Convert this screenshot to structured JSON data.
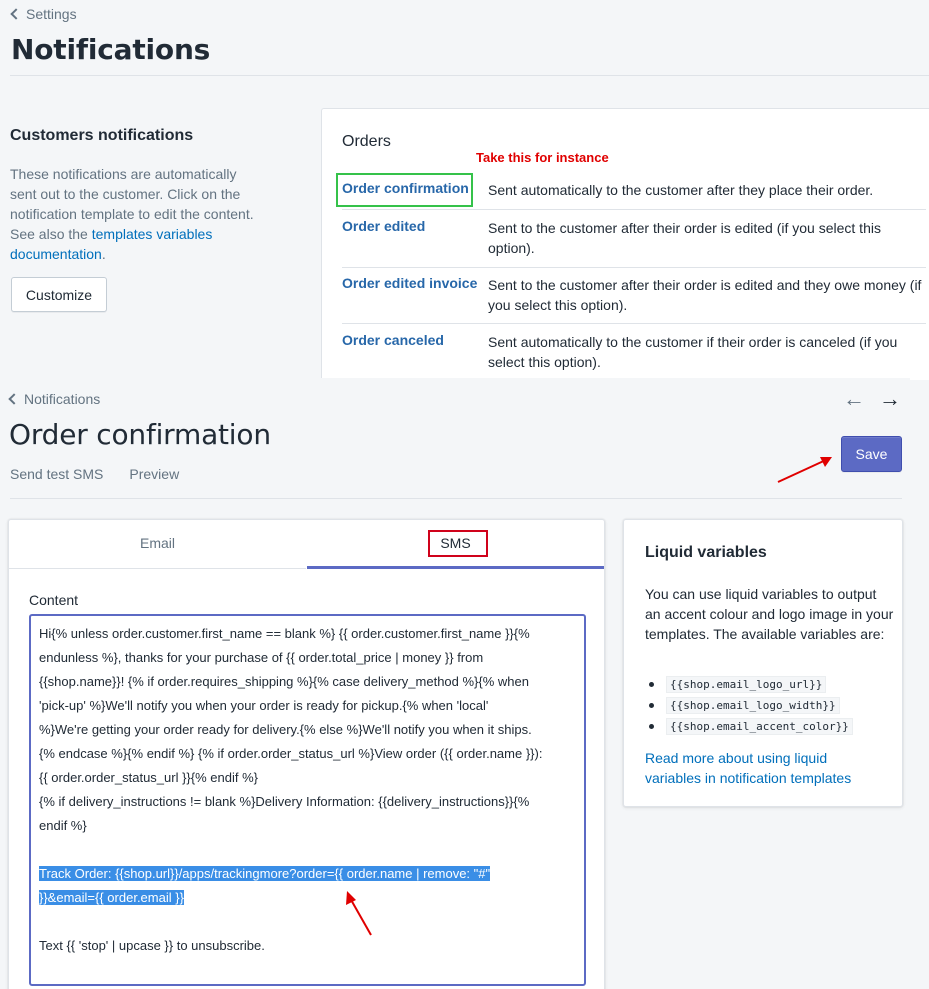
{
  "top": {
    "breadcrumb": "Settings",
    "title": "Notifications",
    "customers": {
      "title": "Customers notifications",
      "description": "These notifications are automatically sent out to the customer. Click on the notification template to edit the content. See also the ",
      "link": "templates variables documentation",
      "period": ".",
      "button": "Customize"
    },
    "orders": {
      "title": "Orders",
      "annotation": "Take this for instance",
      "rows": [
        {
          "name": "Order confirmation",
          "desc": "Sent automatically to the customer after they place their order."
        },
        {
          "name": "Order edited",
          "desc": "Sent to the customer after their order is edited (if you select this option)."
        },
        {
          "name": "Order edited invoice",
          "desc": "Sent to the customer after their order is edited and they owe money (if you select this option)."
        },
        {
          "name": "Order canceled",
          "desc": "Sent automatically to the customer if their order is canceled (if you select this option)."
        }
      ]
    }
  },
  "bottom": {
    "breadcrumb": "Notifications",
    "title": "Order confirmation",
    "actions": [
      "Send test SMS",
      "Preview"
    ],
    "save": "Save",
    "tabs": [
      "Email",
      "SMS"
    ],
    "content_label": "Content",
    "content_lines": [
      "Hi{% unless order.customer.first_name == blank %} {{ order.customer.first_name }}{%",
      "endunless %}, thanks for your purchase of {{ order.total_price | money }} from",
      "{{shop.name}}! {% if order.requires_shipping %}{% case delivery_method %}{% when",
      "'pick-up' %}We'll notify you when your order is ready for pickup.{% when 'local'",
      "%}We're getting your order ready for delivery.{% else %}We'll notify you when it ships.",
      "{% endcase %}{% endif %} {% if order.order_status_url %}View order ({{ order.name }}):",
      "{{ order.order_status_url }}{% endif %}",
      "{% if delivery_instructions != blank  %}Delivery Information: {{delivery_instructions}}{%",
      "endif %}"
    ],
    "selected_lines": [
      "Track Order: {{shop.url}}/apps/trackingmore?order={{ order.name | remove: \"#\" ",
      "}}&email={{ order.email }}"
    ],
    "footer_line": "Text {{ 'stop' | upcase }} to unsubscribe.",
    "liquid": {
      "title": "Liquid variables",
      "description": "You can use liquid variables to output an accent colour and logo image in your templates. The available variables are:",
      "variables": [
        "{{shop.email_logo_url}}",
        "{{shop.email_logo_width}}",
        "{{shop.email_accent_color}}"
      ],
      "link": "Read more about using liquid variables in notification templates"
    }
  },
  "colors": {
    "accent": "#5c6ac4",
    "link": "#006fbb",
    "annotation_red": "#e00000",
    "highlight_green": "#35c24a",
    "selection": "#3a8ee6"
  },
  "icons": [
    "chevron-left-icon",
    "arrow-left-icon",
    "arrow-right-icon",
    "annotation-arrow"
  ]
}
